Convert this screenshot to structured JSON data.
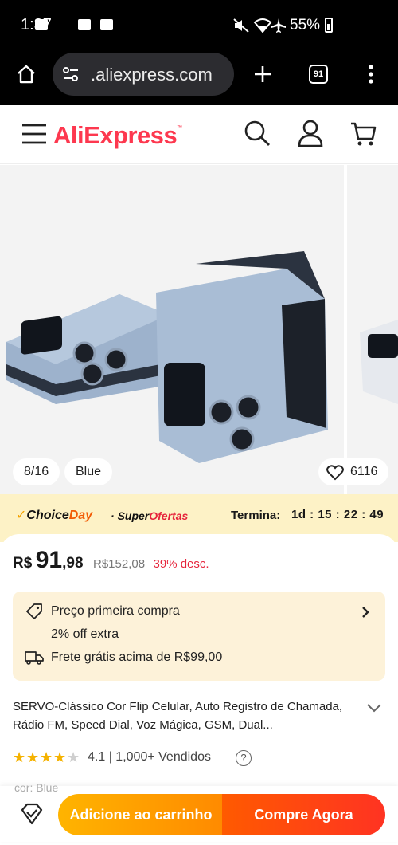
{
  "status_bar": {
    "time": "1:37",
    "battery": "55%"
  },
  "browser": {
    "url": ".aliexpress.com",
    "tab_count": "91"
  },
  "header": {
    "logo": "AliExpress",
    "logo_tm": "™"
  },
  "gallery": {
    "counter": "8/16",
    "variant": "Blue",
    "likes": "6116"
  },
  "promo": {
    "choice": "Choice",
    "day": "Day",
    "separator": "·",
    "super": "Super",
    "ofertas": "Ofertas",
    "ends_label": "Termina:",
    "countdown": "1d : 15 : 22 : 49"
  },
  "price": {
    "currency": "R$",
    "integer": "91",
    "decimal": ",98",
    "original": "R$152,08",
    "discount": "39% desc."
  },
  "offers": {
    "first_purchase": "Preço primeira compra",
    "extra": "2% off extra",
    "shipping": "Frete grátis acima de R$99,00"
  },
  "product": {
    "title": "SERVO-Clássico Cor Flip Celular, Auto Registro de Chamada, Rádio FM, Speed Dial, Voz Mágica, GSM, Dual...",
    "rating": "4.1",
    "rating_stars": 4.1,
    "sold": "1,000+ Vendidos",
    "help": "?",
    "partial_row": "cor: Blue"
  },
  "actions": {
    "add_to_cart": "Adicione ao carrinho",
    "buy_now": "Compre Agora"
  },
  "colors": {
    "brand": "#fd384f",
    "promo_bg": "#fdf2c6",
    "offer_bg": "#fdf2d9",
    "cart": "#ffb400",
    "buy": "#ff3322",
    "discount": "#e6243b"
  }
}
